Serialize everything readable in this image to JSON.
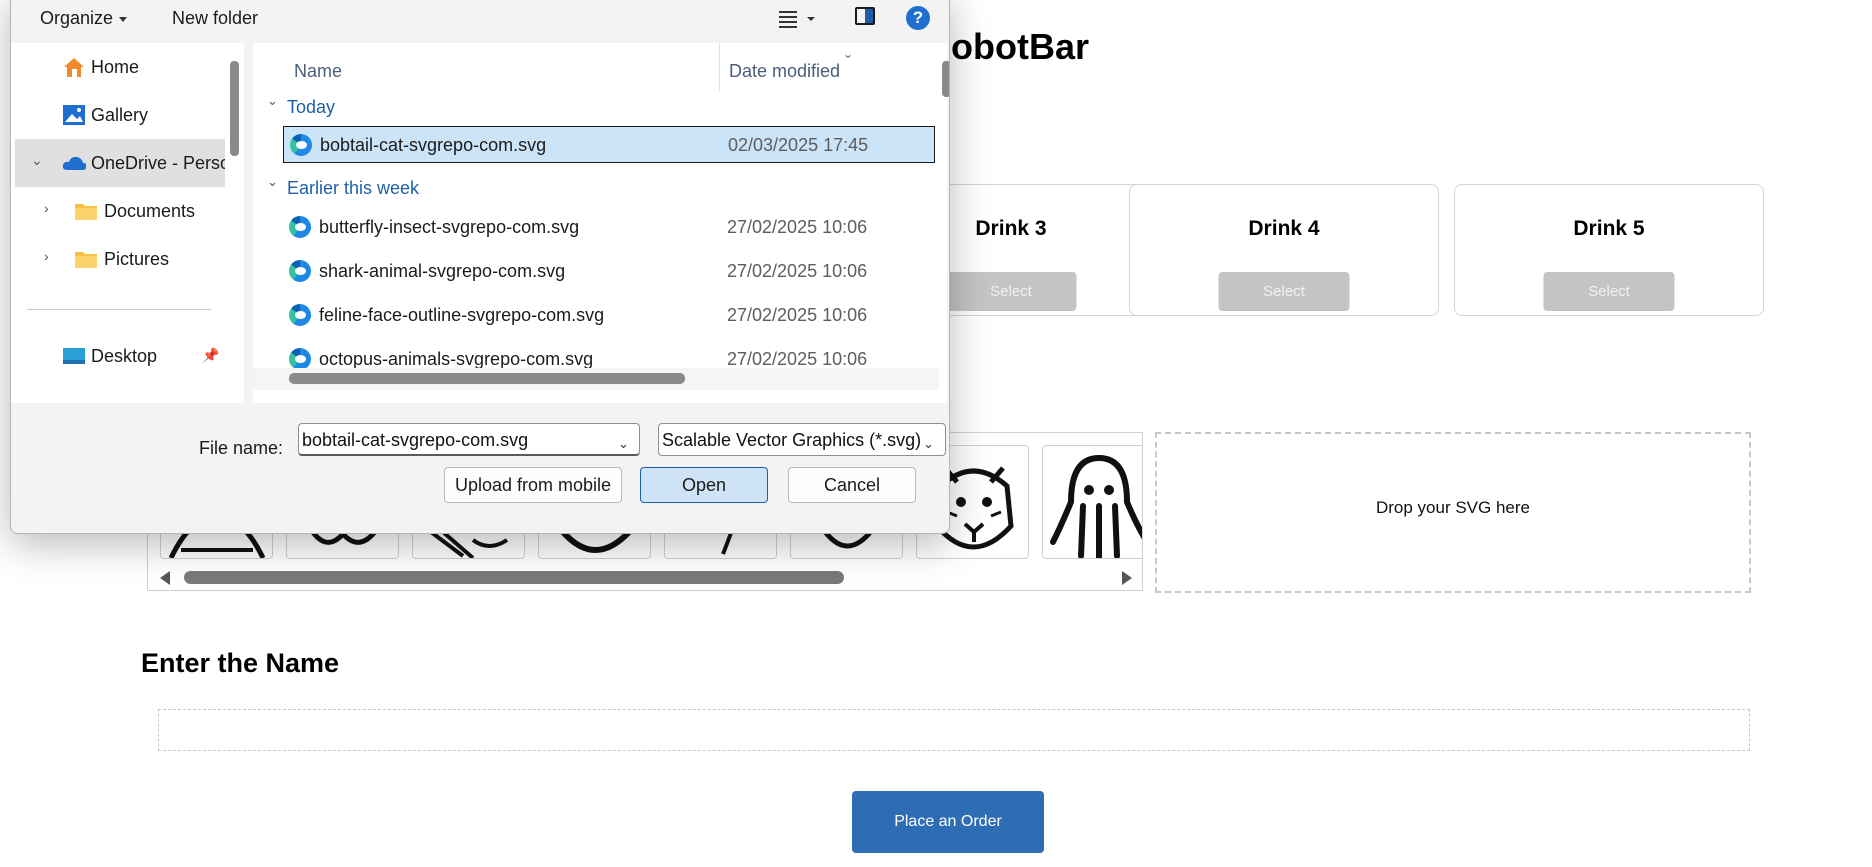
{
  "page": {
    "title": "RobotBar",
    "drinks": [
      {
        "name": "Drink 3",
        "select_label": "Select"
      },
      {
        "name": "Drink 4",
        "select_label": "Select"
      },
      {
        "name": "Drink 5",
        "select_label": "Select"
      }
    ],
    "drop_text": "Drop your SVG here",
    "enter_name_heading": "Enter the Name",
    "name_input_value": "",
    "order_button": "Place an Order"
  },
  "dialog": {
    "toolbar": {
      "organize": "Organize",
      "new_folder": "New folder"
    },
    "nav": [
      {
        "label": "Home",
        "icon": "home-icon"
      },
      {
        "label": "Gallery",
        "icon": "gallery-icon"
      },
      {
        "label": "OneDrive - Perso",
        "icon": "onedrive-icon"
      },
      {
        "label": "Documents",
        "icon": "folder-icon"
      },
      {
        "label": "Pictures",
        "icon": "folder-icon"
      },
      {
        "label": "Desktop",
        "icon": "desktop-icon"
      }
    ],
    "columns": {
      "name": "Name",
      "date": "Date modified"
    },
    "groups": {
      "today": "Today",
      "earlier": "Earlier this week"
    },
    "files": [
      {
        "name": "bobtail-cat-svgrepo-com.svg",
        "date": "02/03/2025 17:45"
      },
      {
        "name": "butterfly-insect-svgrepo-com.svg",
        "date": "27/02/2025 10:06"
      },
      {
        "name": "shark-animal-svgrepo-com.svg",
        "date": "27/02/2025 10:06"
      },
      {
        "name": "feline-face-outline-svgrepo-com.svg",
        "date": "27/02/2025 10:06"
      },
      {
        "name": "octopus-animals-svgrepo-com.svg",
        "date": "27/02/2025 10:06"
      }
    ],
    "file_name_label": "File name:",
    "file_name_value": "bobtail-cat-svgrepo-com.svg",
    "file_type": "Scalable Vector Graphics (*.svg)",
    "buttons": {
      "upload": "Upload from mobile",
      "open": "Open",
      "cancel": "Cancel"
    }
  },
  "colors": {
    "accent": "#2e6db4",
    "selection": "#cce4f7",
    "link": "#1f5fa8"
  }
}
